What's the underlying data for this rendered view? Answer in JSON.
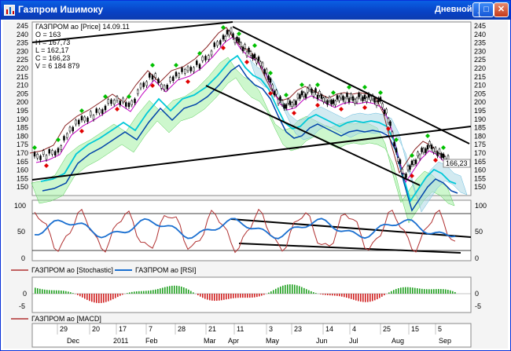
{
  "window": {
    "title": "Газпром Ишимоку",
    "mode_label": "Дневной",
    "buttons": {
      "minimize": "_",
      "maximize": "□",
      "close": "✕"
    }
  },
  "price_panel": {
    "info": {
      "header": "ГАЗПРОМ ао [Price] 14.09.11",
      "open": "O = 163",
      "high": "H = 167,73",
      "low": "L = 162,17",
      "close": "C = 166,23",
      "volume": "V = 6 184 879"
    },
    "last_price_label": "166,23",
    "left_ticks": [
      "245",
      "240",
      "235",
      "230",
      "225",
      "220",
      "215",
      "210",
      "205",
      "200",
      "195",
      "190",
      "185",
      "180",
      "175",
      "170",
      "165",
      "160",
      "155",
      "150"
    ],
    "right_ticks": [
      "245",
      "240",
      "235",
      "230",
      "225",
      "220",
      "215",
      "210",
      "205",
      "200",
      "195",
      "190",
      "185",
      "180",
      "175",
      "170",
      "165",
      "160",
      "155",
      "150"
    ]
  },
  "osc_panel": {
    "ticks_left": [
      "100",
      "50",
      "0"
    ],
    "ticks_right": [
      "100",
      "50",
      "0"
    ],
    "legend_stochastic": "ГАЗПРОМ ао [Stochastic]",
    "legend_rsi": "ГАЗПРОМ ао [RSI]"
  },
  "macd_panel": {
    "ticks_left": [
      "0",
      "-5"
    ],
    "ticks_right": [
      "0",
      "-5"
    ],
    "legend_macd": "ГАЗПРОМ ао [MACD]"
  },
  "time_axis": {
    "top_row": [
      "29",
      "20",
      "17",
      "7",
      "28",
      "21",
      "11",
      "3",
      "23",
      "14",
      "4",
      "25",
      "15",
      "5"
    ],
    "bottom_row": [
      "Dec",
      "2011",
      "Feb",
      "Mar",
      "Apr",
      "May",
      "Jun",
      "Jul",
      "Aug",
      "Sep"
    ]
  },
  "colors": {
    "title_bar": "#0841c4",
    "price_line": "#000000",
    "tenkan": "#c000c0",
    "kijun_lag": "#8b2525",
    "cloud_up": "#90ee90",
    "cloud_down": "#add8e6",
    "ma_cyan": "#00c8d8",
    "ma_blue": "#0044aa",
    "up_marker": "#00c000",
    "down_marker": "#e00000",
    "stochastic": "#b03030",
    "rsi": "#1a6fd0"
  }
}
